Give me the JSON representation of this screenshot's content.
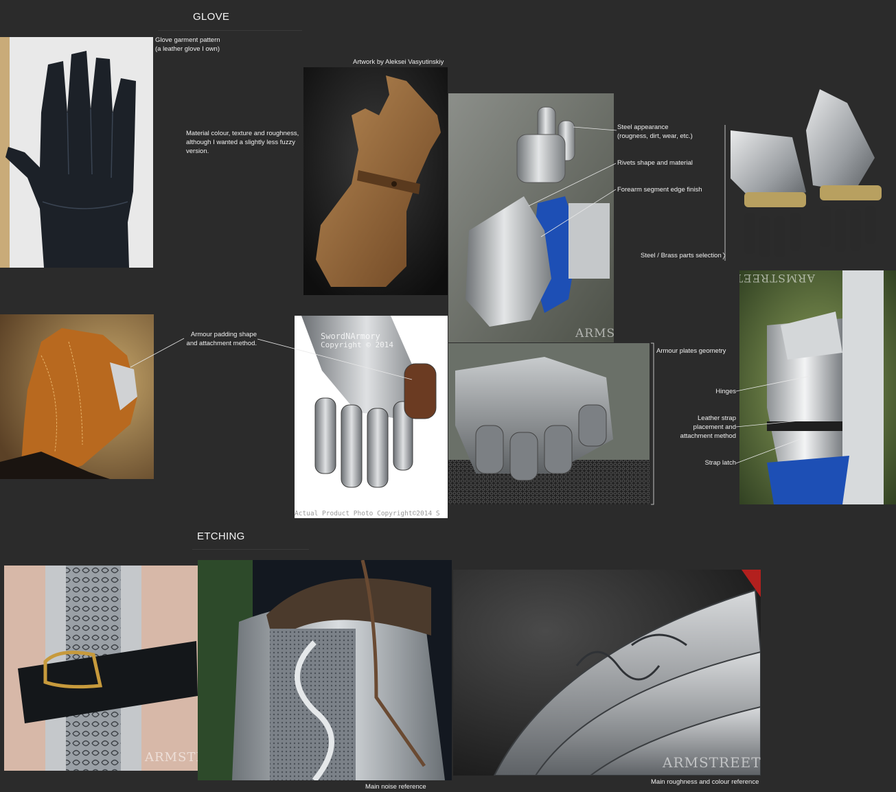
{
  "sections": {
    "glove_title": "GLOVE",
    "etching_title": "ETCHING"
  },
  "notes": {
    "glove_pattern": "Glove garment pattern\n(a leather glove I own)",
    "artwork_credit": "Artwork by Aleksei Vasyutinskiy",
    "material": "Material colour, texture and roughness,\nalthough I wanted a slightly less fuzzy\nversion.",
    "steel_appearance": "Steel appearance\n(rougness, dirt, wear, etc.)",
    "rivets": "Rivets shape and material",
    "forearm_edge": "Forearm segment edge finish",
    "steel_brass": "Steel / Brass parts selection",
    "armour_padding": "Armour padding shape\nand attachment method.",
    "plates_geometry": "Armour plates geometry",
    "hinges": "Hinges",
    "leather_strap": "Leather strap\nplacement and\nattachment method",
    "strap_latch": "Strap latch",
    "noise_ref": "Main noise reference",
    "roughness_ref": "Main roughness and colour reference"
  },
  "watermarks": {
    "armstreet": "ARMSTREET",
    "swordnarmory": "SwordNArmory",
    "sna_copyright": "Copyright © 2014",
    "actual_product": "Actual Product Photo Copyright©2014 S"
  },
  "colors": {
    "background": "#2b2b2b",
    "text": "#f2f2f2",
    "leather_black": "#1c2128",
    "leather_brown": "#8a5a2e",
    "suede_orange": "#b8691f",
    "steel": "#a9adb0",
    "brass": "#b8a060",
    "cloth_blue": "#1d4fb5"
  }
}
